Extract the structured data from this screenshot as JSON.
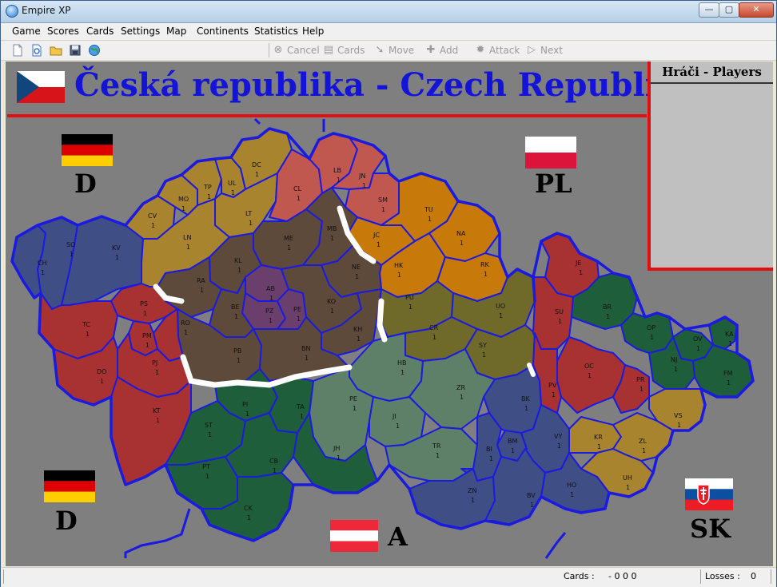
{
  "window": {
    "title": "Empire XP",
    "minimize": "—",
    "maximize": "▢",
    "close": "✕"
  },
  "menu": [
    "Game",
    "Scores",
    "Cards",
    "Settings",
    "Map",
    "Continents",
    "Statistics",
    "Help"
  ],
  "toolbar": {
    "file_icons": [
      "new-file-icon",
      "preview-icon",
      "open-folder-icon",
      "save-icon",
      "globe-icon"
    ],
    "actions": [
      {
        "label": "Cancel",
        "icon": "cancel-icon",
        "enabled": false
      },
      {
        "label": "Cards",
        "icon": "cards-icon",
        "enabled": false
      },
      {
        "label": "Move",
        "icon": "move-icon",
        "enabled": false
      },
      {
        "label": "Add",
        "icon": "add-icon",
        "enabled": false
      },
      {
        "label": "Attack",
        "icon": "attack-icon",
        "enabled": false
      },
      {
        "label": "Next",
        "icon": "next-icon",
        "enabled": false
      }
    ]
  },
  "map": {
    "title": "Česká republika - Czech Republic",
    "players_title": "Hráči - Players",
    "neighbors": [
      {
        "label": "D",
        "flag": "germany"
      },
      {
        "label": "PL",
        "flag": "poland"
      },
      {
        "label": "D",
        "flag": "germany"
      },
      {
        "label": "A",
        "flag": "austria"
      },
      {
        "label": "SK",
        "flag": "slovakia"
      }
    ],
    "regions": [
      {
        "code": "CH",
        "armies": "1",
        "color": "#3f4f86"
      },
      {
        "code": "SO",
        "armies": "1",
        "color": "#3f4f86"
      },
      {
        "code": "KV",
        "armies": "1",
        "color": "#3f4f86"
      },
      {
        "code": "CV",
        "armies": "1",
        "color": "#a8842e"
      },
      {
        "code": "MO",
        "armies": "1",
        "color": "#a8842e"
      },
      {
        "code": "TP",
        "armies": "1",
        "color": "#a8842e"
      },
      {
        "code": "UL",
        "armies": "1",
        "color": "#a8842e"
      },
      {
        "code": "DC",
        "armies": "1",
        "color": "#a8842e"
      },
      {
        "code": "LT",
        "armies": "1",
        "color": "#a8842e"
      },
      {
        "code": "LN",
        "armies": "1",
        "color": "#a8842e"
      },
      {
        "code": "CL",
        "armies": "1",
        "color": "#c0584f"
      },
      {
        "code": "LB",
        "armies": "1",
        "color": "#c0584f"
      },
      {
        "code": "JN",
        "armies": "1",
        "color": "#c0584f"
      },
      {
        "code": "SM",
        "armies": "1",
        "color": "#c0584f"
      },
      {
        "code": "TU",
        "armies": "1",
        "color": "#c77a0a"
      },
      {
        "code": "NA",
        "armies": "1",
        "color": "#c77a0a"
      },
      {
        "code": "JC",
        "armies": "1",
        "color": "#c77a0a"
      },
      {
        "code": "HK",
        "armies": "1",
        "color": "#c77a0a"
      },
      {
        "code": "RK",
        "armies": "1",
        "color": "#c77a0a"
      },
      {
        "code": "ME",
        "armies": "1",
        "color": "#5e4a3a"
      },
      {
        "code": "MB",
        "armies": "1",
        "color": "#5e4a3a"
      },
      {
        "code": "KL",
        "armies": "1",
        "color": "#5e4a3a"
      },
      {
        "code": "RA",
        "armies": "1",
        "color": "#5e4a3a"
      },
      {
        "code": "NE",
        "armies": "1",
        "color": "#5e4a3a"
      },
      {
        "code": "AB",
        "armies": "1",
        "color": "#6b3f6b"
      },
      {
        "code": "PZ",
        "armies": "1",
        "color": "#6b3f6b"
      },
      {
        "code": "PE",
        "armies": "1",
        "color": "#6b3f6b"
      },
      {
        "code": "BE",
        "armies": "1",
        "color": "#5e4a3a"
      },
      {
        "code": "KO",
        "armies": "1",
        "color": "#5e4a3a"
      },
      {
        "code": "KH",
        "armies": "1",
        "color": "#5e4a3a"
      },
      {
        "code": "PB",
        "armies": "1",
        "color": "#5e4a3a"
      },
      {
        "code": "BN",
        "armies": "1",
        "color": "#5e4a3a"
      },
      {
        "code": "PU",
        "armies": "1",
        "color": "#6f6a2a"
      },
      {
        "code": "UO",
        "armies": "1",
        "color": "#6f6a2a"
      },
      {
        "code": "CR",
        "armies": "1",
        "color": "#6f6a2a"
      },
      {
        "code": "SY",
        "armies": "1",
        "color": "#6f6a2a"
      },
      {
        "code": "PS",
        "armies": "1",
        "color": "#a83232"
      },
      {
        "code": "TC",
        "armies": "1",
        "color": "#a83232"
      },
      {
        "code": "RO",
        "armies": "1",
        "color": "#a83232"
      },
      {
        "code": "PM",
        "armies": "1",
        "color": "#a83232"
      },
      {
        "code": "DO",
        "armies": "1",
        "color": "#a83232"
      },
      {
        "code": "PJ",
        "armies": "1",
        "color": "#a83232"
      },
      {
        "code": "KT",
        "armies": "1",
        "color": "#a83232"
      },
      {
        "code": "HB",
        "armies": "1",
        "color": "#5e8068"
      },
      {
        "code": "ZR",
        "armies": "1",
        "color": "#5e8068"
      },
      {
        "code": "PE",
        "armies": "1",
        "color": "#5e8068"
      },
      {
        "code": "JI",
        "armies": "1",
        "color": "#5e8068"
      },
      {
        "code": "TR",
        "armies": "1",
        "color": "#5e8068"
      },
      {
        "code": "PI",
        "armies": "1",
        "color": "#1f5e3a"
      },
      {
        "code": "ST",
        "armies": "1",
        "color": "#1f5e3a"
      },
      {
        "code": "TA",
        "armies": "1",
        "color": "#1f5e3a"
      },
      {
        "code": "PT",
        "armies": "1",
        "color": "#1f5e3a"
      },
      {
        "code": "CB",
        "armies": "1",
        "color": "#1f5e3a"
      },
      {
        "code": "JH",
        "armies": "1",
        "color": "#1f5e3a"
      },
      {
        "code": "CK",
        "armies": "1",
        "color": "#1f5e3a"
      },
      {
        "code": "BK",
        "armies": "1",
        "color": "#3f4f86"
      },
      {
        "code": "BM",
        "armies": "1",
        "color": "#3f4f86"
      },
      {
        "code": "BI",
        "armies": "1",
        "color": "#3f4f86"
      },
      {
        "code": "VY",
        "armies": "1",
        "color": "#3f4f86"
      },
      {
        "code": "ZN",
        "armies": "1",
        "color": "#3f4f86"
      },
      {
        "code": "BV",
        "armies": "1",
        "color": "#3f4f86"
      },
      {
        "code": "HO",
        "armies": "1",
        "color": "#3f4f86"
      },
      {
        "code": "JE",
        "armies": "1",
        "color": "#a83232"
      },
      {
        "code": "SU",
        "armies": "1",
        "color": "#a83232"
      },
      {
        "code": "OC",
        "armies": "1",
        "color": "#a83232"
      },
      {
        "code": "PV",
        "armies": "1",
        "color": "#a83232"
      },
      {
        "code": "PR",
        "armies": "1",
        "color": "#a83232"
      },
      {
        "code": "BR",
        "armies": "1",
        "color": "#1f5e3a"
      },
      {
        "code": "OP",
        "armies": "1",
        "color": "#1f5e3a"
      },
      {
        "code": "KA",
        "armies": "1",
        "color": "#1f5e3a"
      },
      {
        "code": "OV",
        "armies": "1",
        "color": "#1f5e3a"
      },
      {
        "code": "NJ",
        "armies": "1",
        "color": "#1f5e3a"
      },
      {
        "code": "FM",
        "armies": "1",
        "color": "#1f5e3a"
      },
      {
        "code": "VS",
        "armies": "1",
        "color": "#a8842e"
      },
      {
        "code": "KR",
        "armies": "1",
        "color": "#a8842e"
      },
      {
        "code": "ZL",
        "armies": "1",
        "color": "#a8842e"
      },
      {
        "code": "UH",
        "armies": "1",
        "color": "#a8842e"
      }
    ]
  },
  "status": {
    "cards_label": "Cards :",
    "cards_value": "- 0 0 0",
    "losses_label": "Losses :",
    "losses_value": "0"
  },
  "colors": {
    "title_blue": "#1414d8",
    "border_red": "#e01010",
    "region_border": "#1a1ae0",
    "background": "#7f7f7f"
  }
}
